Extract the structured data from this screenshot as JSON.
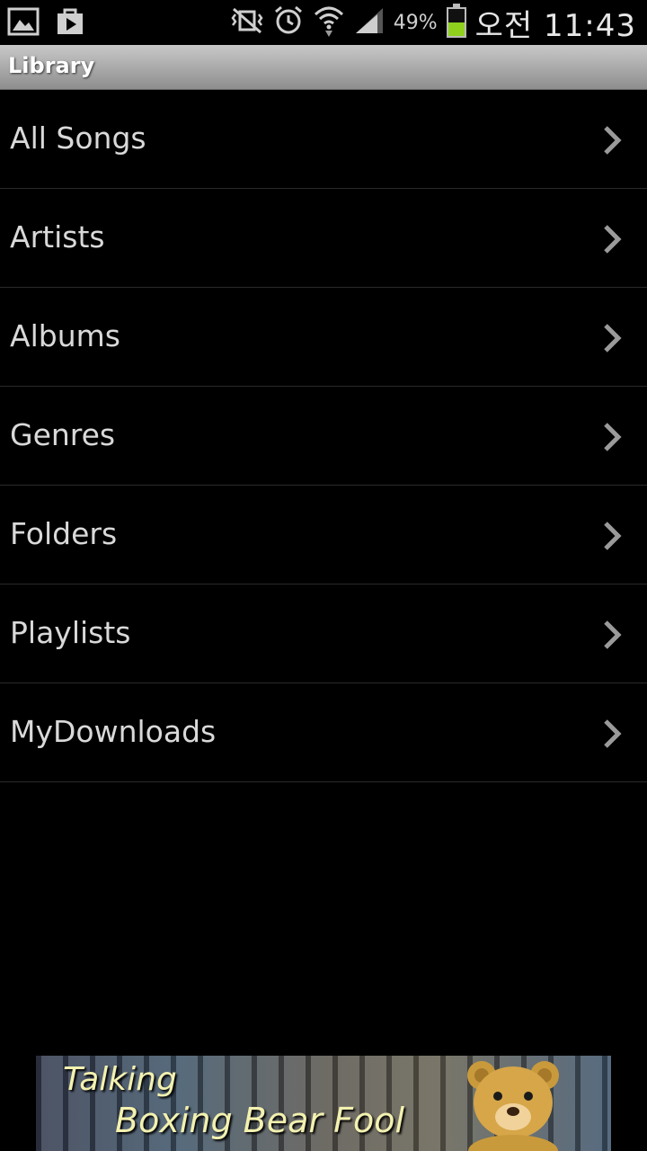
{
  "status_bar": {
    "battery_text": "49%",
    "battery_level": 0.49,
    "clock": "오전 11:43",
    "icons": [
      "gallery-icon",
      "play-store-icon",
      "vibrate-mute-icon",
      "alarm-icon",
      "wifi-icon",
      "signal-icon",
      "battery-icon"
    ]
  },
  "header": {
    "title": "Library"
  },
  "library": {
    "items": [
      {
        "label": "All Songs"
      },
      {
        "label": "Artists"
      },
      {
        "label": "Albums"
      },
      {
        "label": "Genres"
      },
      {
        "label": "Folders"
      },
      {
        "label": "Playlists"
      },
      {
        "label": "MyDownloads"
      }
    ]
  },
  "ad": {
    "line1": "Talking",
    "line2": "Boxing Bear Fool"
  },
  "colors": {
    "background": "#000000",
    "divider": "#2a2a2a",
    "battery_fill": "#8fd11d",
    "ad_text": "#f3f1b0"
  }
}
